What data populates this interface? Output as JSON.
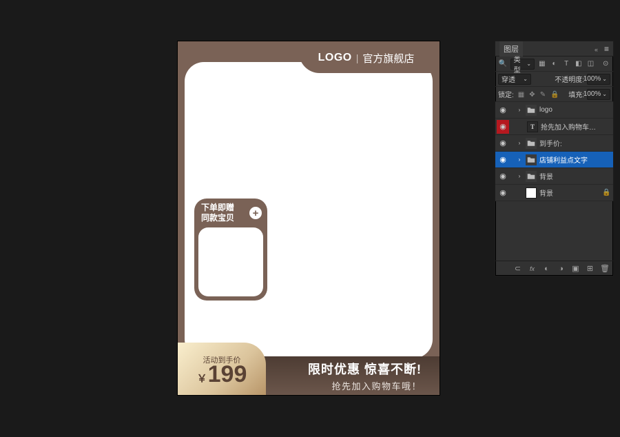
{
  "canvas": {
    "logo": "LOGO",
    "logo_sep": "|",
    "logo_subtitle": "官方旗舰店",
    "gift_line1": "下单即赠",
    "gift_line2": "同款宝贝",
    "gift_plus": "+",
    "bottom_headline": "限时优惠 惊喜不断!",
    "bottom_subline": "抢先加入购物车哦！",
    "price_label": "活动到手价",
    "price_currency": "￥",
    "price_value": "199"
  },
  "panel": {
    "tab_label": "图层",
    "search_label": "类型",
    "blend_mode": "穿透",
    "opacity_label": "不透明度:",
    "opacity_value": "100%",
    "lock_label": "锁定:",
    "fill_label": "填充:",
    "fill_value": "100%"
  },
  "layers": [
    {
      "name": "logo",
      "kind": "folder",
      "eye": true,
      "red": false,
      "sel": false,
      "locked": false
    },
    {
      "name": "抢先加入购物车哦！",
      "kind": "text",
      "eye": true,
      "red": true,
      "sel": false,
      "locked": false
    },
    {
      "name": "到手价:",
      "kind": "folder",
      "eye": true,
      "red": false,
      "sel": false,
      "locked": false
    },
    {
      "name": "店铺利益点文字",
      "kind": "folder",
      "eye": true,
      "red": false,
      "sel": true,
      "locked": false
    },
    {
      "name": "背景",
      "kind": "folder",
      "eye": true,
      "red": false,
      "sel": false,
      "locked": false
    },
    {
      "name": "背景",
      "kind": "white",
      "eye": true,
      "red": false,
      "sel": false,
      "locked": true
    }
  ],
  "icons": {
    "eye": "◉",
    "twisty": "›",
    "folder": "▣",
    "text_T": "T",
    "lock": "🔒",
    "search": "🔍",
    "menu": "≡",
    "collapse": "«",
    "dropdown": "⌄",
    "footer": {
      "link": "⊂",
      "fx": "fx",
      "mask": "◐",
      "adj": "◑",
      "group": "▣",
      "new": "⊞",
      "trash": "🗑"
    }
  }
}
